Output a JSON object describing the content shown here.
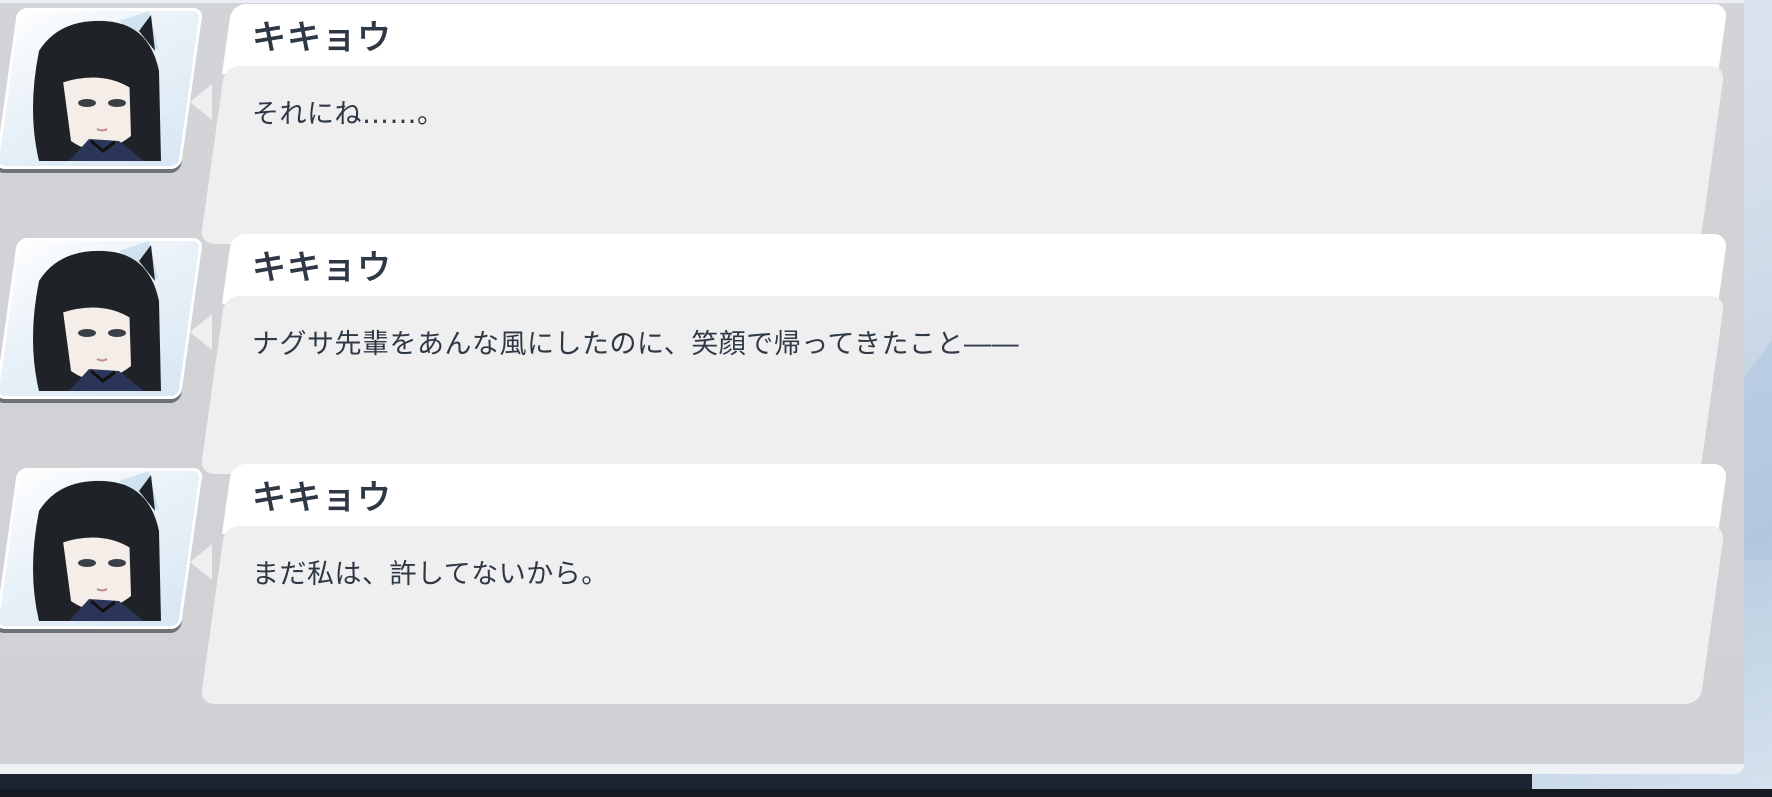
{
  "log": {
    "entries": [
      {
        "speaker": "キキョウ",
        "message": "それにね……。"
      },
      {
        "speaker": "キキョウ",
        "message": "ナグサ先輩をあんな風にしたのに、笑顔で帰ってきたこと――"
      },
      {
        "speaker": "キキョウ",
        "message": "まだ私は、許してないから。"
      }
    ]
  },
  "colors": {
    "panel": "#d2d4d8",
    "bubble": "#efefef",
    "name_tab": "#ffffff",
    "text": "#2f3946",
    "frame": "#1d2431"
  },
  "icons": {
    "avatar": "character-portrait"
  }
}
